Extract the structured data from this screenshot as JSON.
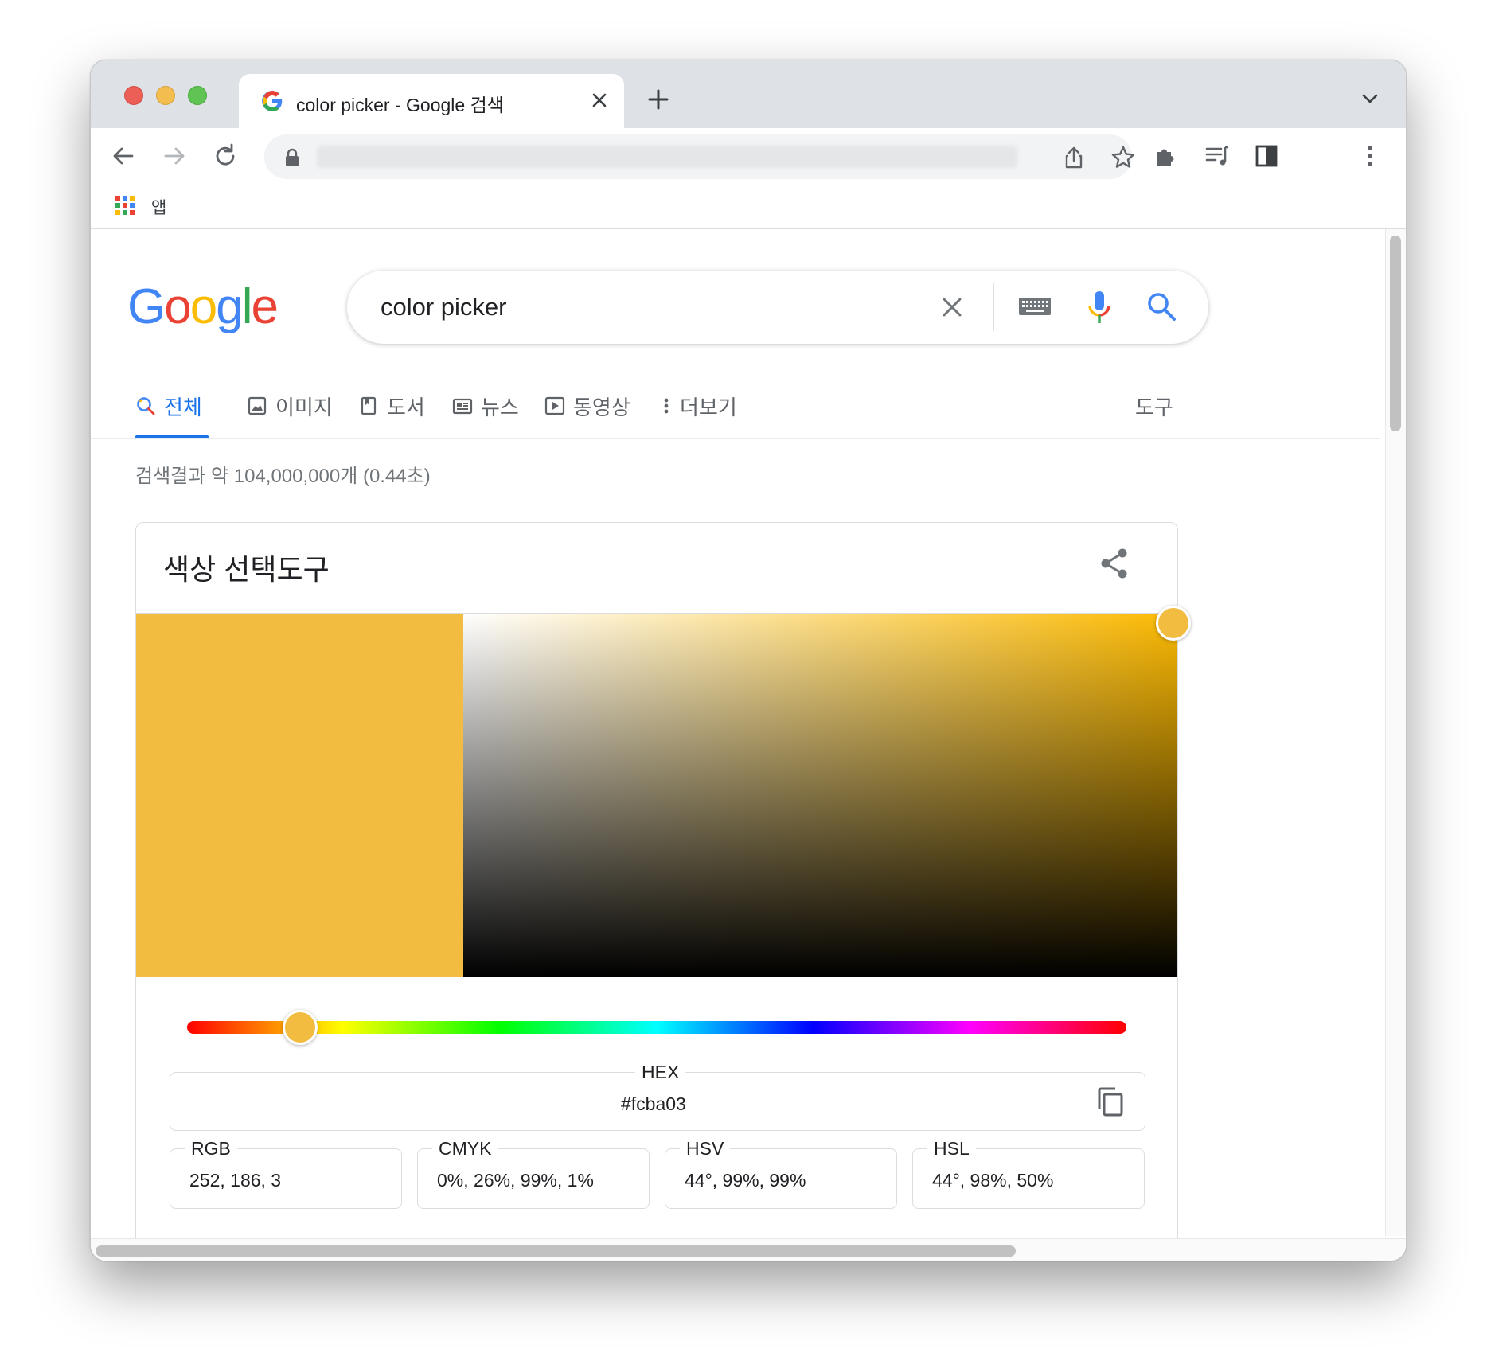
{
  "browser": {
    "tab_title": "color picker - Google 검색",
    "bookmarks": {
      "apps_label": "앱"
    }
  },
  "search": {
    "query": "color picker",
    "logo_letters": [
      {
        "ch": "G",
        "color": "#4285f4"
      },
      {
        "ch": "o",
        "color": "#ea4335"
      },
      {
        "ch": "o",
        "color": "#fbbc05"
      },
      {
        "ch": "g",
        "color": "#4285f4"
      },
      {
        "ch": "l",
        "color": "#34a853"
      },
      {
        "ch": "e",
        "color": "#ea4335"
      }
    ]
  },
  "nav": {
    "all": "전체",
    "images": "이미지",
    "books": "도서",
    "news": "뉴스",
    "videos": "동영상",
    "more": "더보기",
    "tools": "도구"
  },
  "result_stats": "검색결과 약 104,000,000개 (0.44초)",
  "color_picker": {
    "title": "색상 선택도구",
    "selected_color": "#f2bc40",
    "hue_position": 0.12,
    "hex": {
      "label": "HEX",
      "value": "#fcba03"
    },
    "rgb": {
      "label": "RGB",
      "value": "252, 186, 3"
    },
    "cmyk": {
      "label": "CMYK",
      "value": "0%, 26%, 99%, 1%"
    },
    "hsv": {
      "label": "HSV",
      "value": "44°, 99%, 99%"
    },
    "hsl": {
      "label": "HSL",
      "value": "44°, 98%, 50%"
    }
  },
  "colors": {
    "accent_blue": "#1a73e8",
    "tabstrip_bg": "#dee1e6"
  }
}
